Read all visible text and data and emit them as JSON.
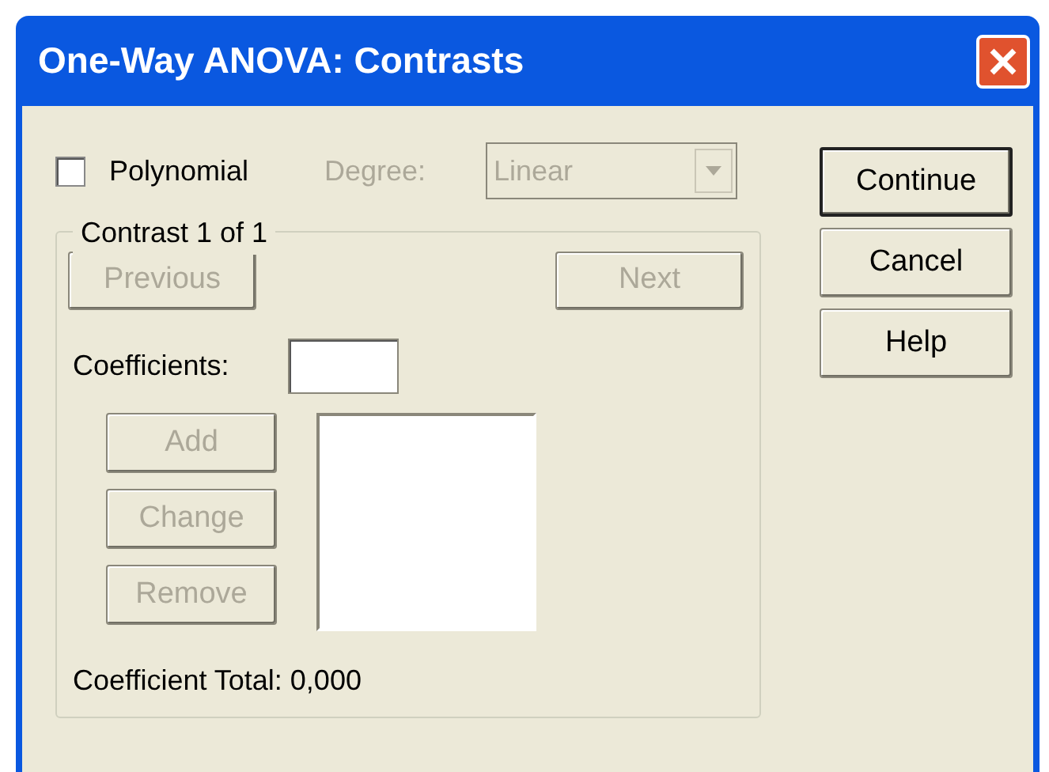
{
  "window": {
    "title": "One-Way ANOVA: Contrasts"
  },
  "polynomial": {
    "label": "Polynomial",
    "checked": false
  },
  "degree": {
    "label": "Degree:",
    "value": "Linear",
    "disabled": true
  },
  "side_buttons": [
    {
      "label": "Continue",
      "default": true
    },
    {
      "label": "Cancel",
      "default": false
    },
    {
      "label": "Help",
      "default": false
    }
  ],
  "contrast_group": {
    "title": "Contrast 1 of 1",
    "previous": {
      "label": "Previous",
      "disabled": true
    },
    "next": {
      "label": "Next",
      "disabled": true
    },
    "coefficients_label": "Coefficients:",
    "list_buttons": [
      {
        "label": "Add",
        "disabled": true
      },
      {
        "label": "Change",
        "disabled": true
      },
      {
        "label": "Remove",
        "disabled": true
      }
    ],
    "coefficient_total": "Coefficient Total: 0,000"
  }
}
